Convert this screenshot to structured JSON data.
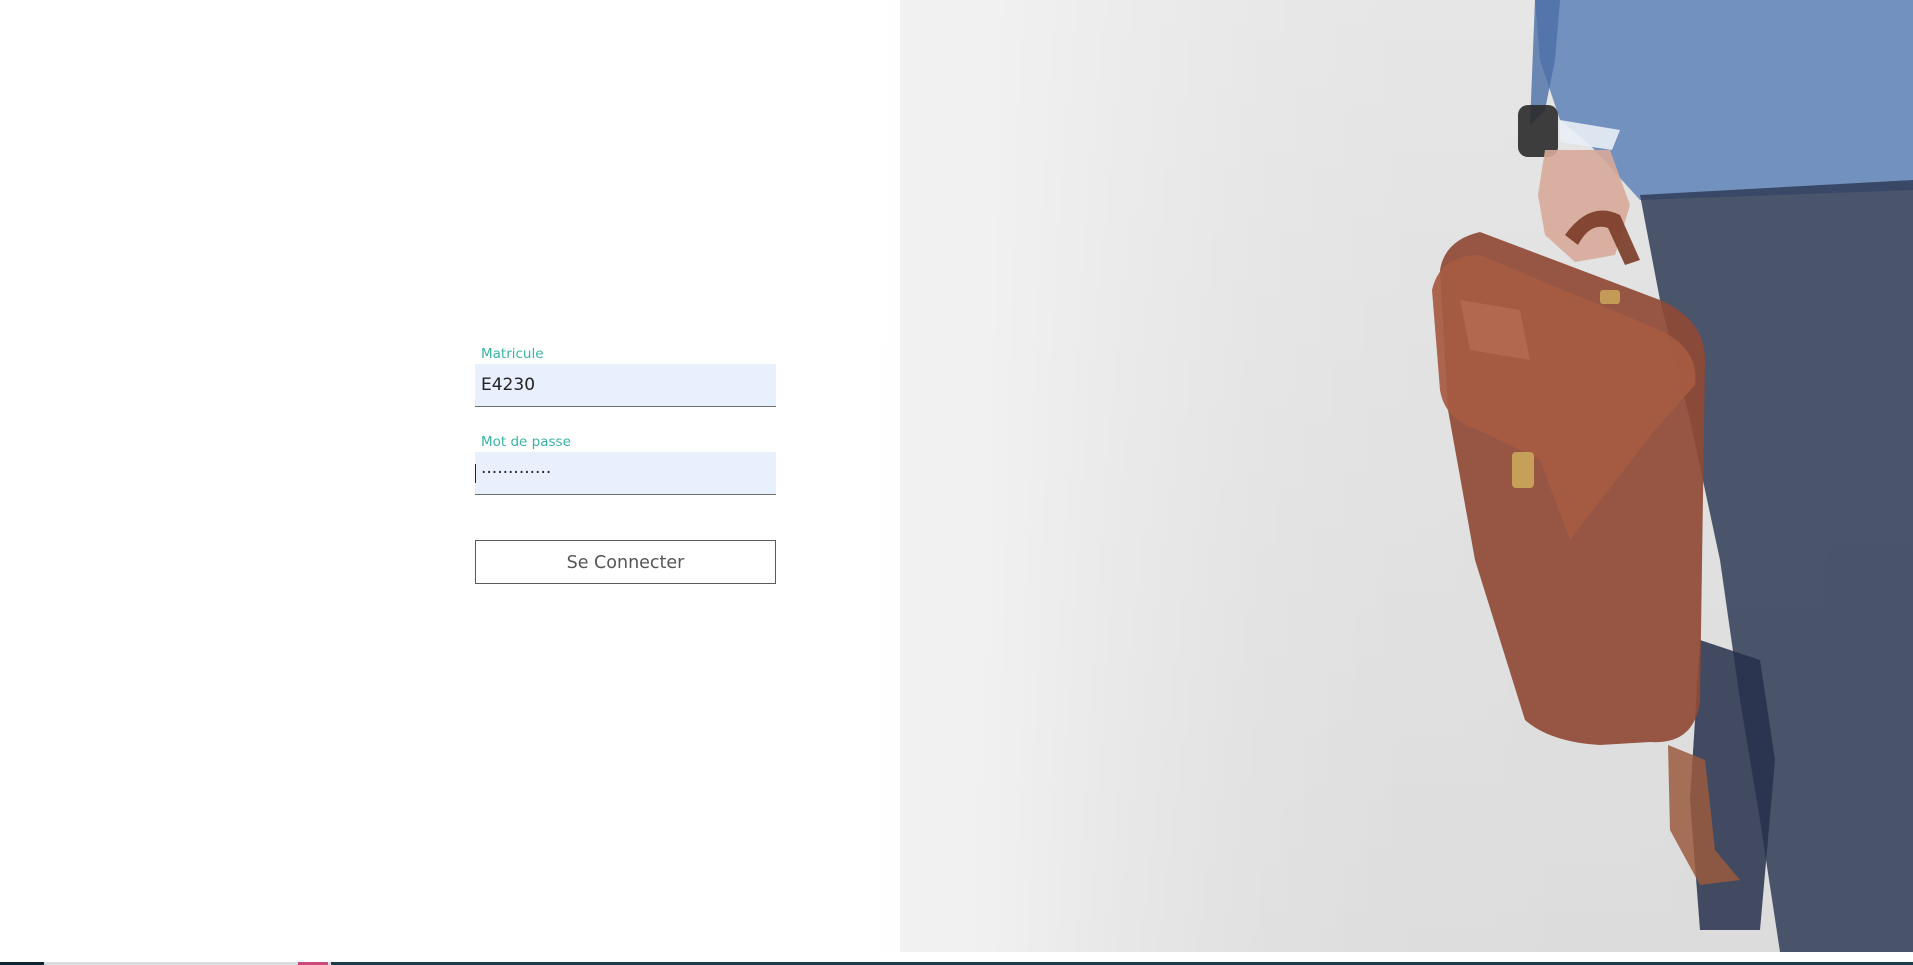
{
  "login": {
    "username_label": "Matricule",
    "username_value": "E4230",
    "password_label": "Mot de passe",
    "password_masked": "·············",
    "submit_label": "Se Connecter"
  },
  "colors": {
    "label_accent": "#3ab3a6",
    "autofill_bg": "#e8f0fe",
    "button_border": "#5a5a5a"
  },
  "background": {
    "image": "businessman-with-briefcase-photo"
  }
}
